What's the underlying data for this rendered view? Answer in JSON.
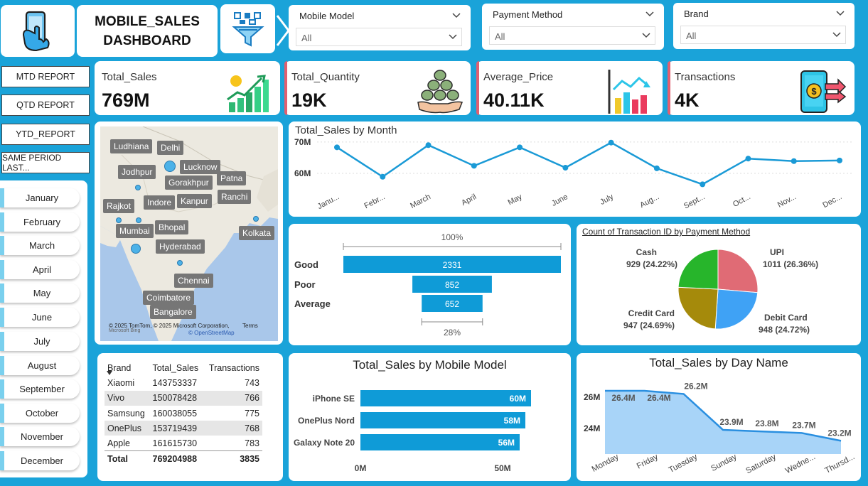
{
  "header": {
    "title_line1": "MOBILE_SALES",
    "title_line2": "DASHBOARD",
    "logo_icon": "smartphone-hand-icon",
    "filter_icon": "funnel-filter-icon"
  },
  "slicers": [
    {
      "label": "Mobile Model",
      "value": "All"
    },
    {
      "label": "Payment Method",
      "value": "All"
    },
    {
      "label": "Brand",
      "value": "All"
    }
  ],
  "report_buttons": [
    "MTD REPORT",
    "QTD REPORT",
    "YTD_REPORT",
    "SAME PERIOD LAST..."
  ],
  "months": [
    "January",
    "February",
    "March",
    "April",
    "May",
    "June",
    "July",
    "August",
    "September",
    "October",
    "November",
    "December"
  ],
  "kpis": [
    {
      "label": "Total_Sales",
      "value": "769M",
      "icon": "growth-chart-icon"
    },
    {
      "label": "Total_Quantity",
      "value": "19K",
      "icon": "coins-hand-icon"
    },
    {
      "label": "Average_Price",
      "value": "40.11K",
      "icon": "bar-arrow-chart-icon"
    },
    {
      "label": "Transactions",
      "value": "4K",
      "icon": "phone-payment-icon"
    }
  ],
  "map": {
    "cities": [
      "Ludhiana",
      "Delhi",
      "Lucknow",
      "Jodhpur",
      "Patna",
      "Gorakhpur",
      "Ranchi",
      "Rajkot",
      "Indore",
      "Kanpur",
      "Bhopal",
      "Mumbai",
      "Kolkata",
      "Hyderabad",
      "Chennai",
      "Coimbatore",
      "Bangalore"
    ],
    "copyright": "© 2025 TomTom, © 2025 Microsoft Corporation,",
    "terms": "Terms",
    "osm": "© OpenStreetMap",
    "bing": "Microsoft Bing"
  },
  "chart_data": [
    {
      "type": "line",
      "title": "Total_Sales by Month",
      "categories": [
        "Janu...",
        "Febr...",
        "March",
        "April",
        "May",
        "June",
        "July",
        "Aug...",
        "Sept...",
        "Oct...",
        "Nov...",
        "Dec..."
      ],
      "values": [
        68.3,
        58.9,
        69.0,
        62.4,
        68.3,
        61.8,
        69.8,
        61.6,
        56.5,
        64.7,
        63.9,
        64.1
      ],
      "ylabels": [
        "70M",
        "60M"
      ],
      "yticks": [
        70,
        60
      ],
      "ylim": [
        55,
        72
      ],
      "color": "#1a9ad6"
    },
    {
      "type": "bar",
      "title": "",
      "orientation": "funnel",
      "categories": [
        "Good",
        "Poor",
        "Average"
      ],
      "values": [
        2331,
        852,
        652
      ],
      "top_label": "100%",
      "bottom_label": "28%",
      "color": "#0f9bd7"
    },
    {
      "type": "pie",
      "title": "Count of Transaction ID by Payment Method",
      "categories": [
        "UPI",
        "Debit Card",
        "Credit Card",
        "Cash"
      ],
      "values": [
        1011,
        948,
        947,
        929
      ],
      "value_labels": [
        "1011 (26.36%)",
        "948 (24.72%)",
        "947 (24.69%)",
        "929 (24.22%)"
      ],
      "colors": [
        "#e06b75",
        "#3fa2f5",
        "#a58a0b",
        "#27b52b"
      ]
    },
    {
      "type": "bar",
      "title": "Total_Sales by Mobile Model",
      "orientation": "horizontal",
      "categories": [
        "iPhone SE",
        "OnePlus Nord",
        "Galaxy Note 20"
      ],
      "values": [
        60,
        58,
        56
      ],
      "value_labels": [
        "60M",
        "58M",
        "56M"
      ],
      "xlabels": [
        "0M",
        "50M"
      ],
      "xticks": [
        0,
        50
      ],
      "xlim": [
        0,
        61.5
      ],
      "color": "#0f9bd7"
    },
    {
      "type": "area",
      "title": "Total_Sales by Day Name",
      "categories": [
        "Monday",
        "Friday",
        "Tuesday",
        "Sunday",
        "Saturday",
        "Wedne...",
        "Thursd..."
      ],
      "values": [
        26.4,
        26.4,
        26.2,
        23.9,
        23.8,
        23.7,
        23.2
      ],
      "value_labels": [
        "26.4M",
        "26.4M",
        "26.2M",
        "23.9M",
        "23.8M",
        "23.7M",
        "23.2M"
      ],
      "ylabels": [
        "26M",
        "24M"
      ],
      "yticks": [
        26,
        24
      ],
      "ylim": [
        22.9,
        26.9
      ],
      "color": "#2a8fe0",
      "fill": "#a8d4f8"
    }
  ],
  "brand_table": {
    "headers": [
      "Brand",
      "Total_Sales",
      "Transactions"
    ],
    "rows": [
      [
        "Xiaomi",
        "143753337",
        "743"
      ],
      [
        "Vivo",
        "150078428",
        "766"
      ],
      [
        "Samsung",
        "160038055",
        "775"
      ],
      [
        "OnePlus",
        "153719439",
        "768"
      ],
      [
        "Apple",
        "161615730",
        "783"
      ]
    ],
    "total": [
      "Total",
      "769204988",
      "3835"
    ]
  }
}
